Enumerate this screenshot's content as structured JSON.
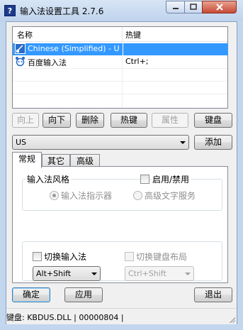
{
  "window": {
    "title": "输入法设置工具 2.7.6",
    "app_icon_glyph": "?"
  },
  "list": {
    "columns": [
      "名称",
      "热键"
    ],
    "rows": [
      {
        "name": "Chinese (Simplified) - US...",
        "hotkey": "",
        "selected": true,
        "icon": "keyboard-layout-icon"
      },
      {
        "name": "百度输入法",
        "hotkey": "Ctrl+;",
        "selected": false,
        "icon": "baidu-ime-icon"
      }
    ]
  },
  "actions": {
    "up": "向上",
    "down": "向下",
    "delete": "删除",
    "hotkey": "热键",
    "properties": "属性",
    "keyboard": "键盘"
  },
  "add_row": {
    "layout_value": "US",
    "add_label": "添加"
  },
  "tabs": [
    "常规",
    "其它",
    "高级"
  ],
  "general": {
    "style_group_label": "输入法风格",
    "enable_disable_label": "启用/禁用",
    "radio_indicator": "输入法指示器",
    "radio_advanced": "高级文字服务",
    "switch_ime_label": "切换输入法",
    "switch_ime_value": "Alt+Shift",
    "switch_kbd_label": "切换键盘布局",
    "switch_kbd_value": "Ctrl+Shift"
  },
  "footer": {
    "ok": "确定",
    "apply": "应用",
    "exit": "退出"
  },
  "status": {
    "text": "键盘: KBDUS.DLL | 00000804 |"
  },
  "colors": {
    "selection": "#3399ff",
    "titlebar": "#c2d6ee"
  }
}
